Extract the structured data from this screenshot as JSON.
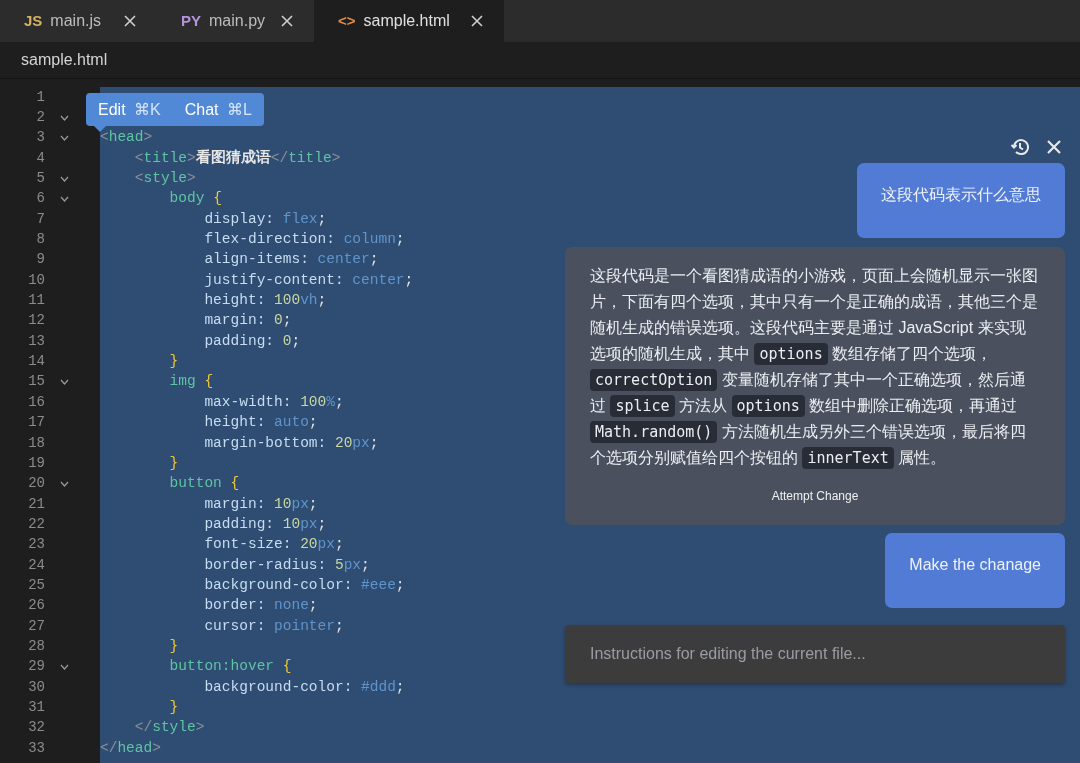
{
  "tabs": [
    {
      "icon": "JS",
      "color": "#d6b25e",
      "label": "main.js",
      "selected": false
    },
    {
      "icon": "PY",
      "color": "#b493d9",
      "label": "main.py",
      "selected": false
    },
    {
      "icon": "<>",
      "color": "#e08a4c",
      "label": "sample.html",
      "selected": true
    }
  ],
  "breadcrumb": "sample.html",
  "editor": {
    "lines": [
      {
        "number": "1",
        "foldable": false
      },
      {
        "number": "2",
        "foldable": true
      },
      {
        "number": "3",
        "foldable": true,
        "tokens": [
          {
            "kind": "punct",
            "t": "<"
          },
          {
            "kind": "tag",
            "t": "head"
          },
          {
            "kind": "punct",
            "t": ">"
          }
        ]
      },
      {
        "number": "4",
        "foldable": false,
        "tokens": [
          {
            "kind": "punct",
            "t": "    <"
          },
          {
            "kind": "tag",
            "t": "title"
          },
          {
            "kind": "punct",
            "t": ">"
          },
          {
            "kind": "text",
            "t": "看图猜成语"
          },
          {
            "kind": "punct",
            "t": "</"
          },
          {
            "kind": "tag",
            "t": "title"
          },
          {
            "kind": "punct",
            "t": ">"
          }
        ]
      },
      {
        "number": "5",
        "foldable": true,
        "tokens": [
          {
            "kind": "punct",
            "t": "    <"
          },
          {
            "kind": "tag",
            "t": "style"
          },
          {
            "kind": "punct",
            "t": ">"
          }
        ]
      },
      {
        "number": "6",
        "foldable": true,
        "tokens": [
          {
            "kind": "tag",
            "t": "        body "
          },
          {
            "kind": "brace",
            "t": "{"
          }
        ]
      },
      {
        "number": "7",
        "foldable": false,
        "tokens": [
          {
            "kind": "prop",
            "t": "            display: "
          },
          {
            "kind": "value",
            "t": "flex"
          },
          {
            "kind": "text",
            "t": ";"
          }
        ]
      },
      {
        "number": "8",
        "foldable": false,
        "tokens": [
          {
            "kind": "prop",
            "t": "            flex-direction: "
          },
          {
            "kind": "value",
            "t": "column"
          },
          {
            "kind": "text",
            "t": ";"
          }
        ]
      },
      {
        "number": "9",
        "foldable": false,
        "tokens": [
          {
            "kind": "prop",
            "t": "            align-items: "
          },
          {
            "kind": "value",
            "t": "center"
          },
          {
            "kind": "text",
            "t": ";"
          }
        ]
      },
      {
        "number": "10",
        "foldable": false,
        "tokens": [
          {
            "kind": "prop",
            "t": "            justify-content: "
          },
          {
            "kind": "value",
            "t": "center"
          },
          {
            "kind": "text",
            "t": ";"
          }
        ]
      },
      {
        "number": "11",
        "foldable": false,
        "tokens": [
          {
            "kind": "prop",
            "t": "            height: "
          },
          {
            "kind": "num",
            "t": "100"
          },
          {
            "kind": "value",
            "t": "vh"
          },
          {
            "kind": "text",
            "t": ";"
          }
        ]
      },
      {
        "number": "12",
        "foldable": false,
        "tokens": [
          {
            "kind": "prop",
            "t": "            margin: "
          },
          {
            "kind": "num",
            "t": "0"
          },
          {
            "kind": "text",
            "t": ";"
          }
        ]
      },
      {
        "number": "13",
        "foldable": false,
        "tokens": [
          {
            "kind": "prop",
            "t": "            padding: "
          },
          {
            "kind": "num",
            "t": "0"
          },
          {
            "kind": "text",
            "t": ";"
          }
        ]
      },
      {
        "number": "14",
        "foldable": false,
        "tokens": [
          {
            "kind": "brace",
            "t": "        }"
          }
        ]
      },
      {
        "number": "15",
        "foldable": true,
        "tokens": [
          {
            "kind": "tag",
            "t": "        img "
          },
          {
            "kind": "brace",
            "t": "{"
          }
        ]
      },
      {
        "number": "16",
        "foldable": false,
        "tokens": [
          {
            "kind": "prop",
            "t": "            max-width: "
          },
          {
            "kind": "num",
            "t": "100"
          },
          {
            "kind": "value",
            "t": "%"
          },
          {
            "kind": "text",
            "t": ";"
          }
        ]
      },
      {
        "number": "17",
        "foldable": false,
        "tokens": [
          {
            "kind": "prop",
            "t": "            height: "
          },
          {
            "kind": "value",
            "t": "auto"
          },
          {
            "kind": "text",
            "t": ";"
          }
        ]
      },
      {
        "number": "18",
        "foldable": false,
        "tokens": [
          {
            "kind": "prop",
            "t": "            margin-bottom: "
          },
          {
            "kind": "num",
            "t": "20"
          },
          {
            "kind": "value",
            "t": "px"
          },
          {
            "kind": "text",
            "t": ";"
          }
        ]
      },
      {
        "number": "19",
        "foldable": false,
        "tokens": [
          {
            "kind": "brace",
            "t": "        }"
          }
        ]
      },
      {
        "number": "20",
        "foldable": true,
        "tokens": [
          {
            "kind": "tag",
            "t": "        button "
          },
          {
            "kind": "brace",
            "t": "{"
          }
        ]
      },
      {
        "number": "21",
        "foldable": false,
        "tokens": [
          {
            "kind": "prop",
            "t": "            margin: "
          },
          {
            "kind": "num",
            "t": "10"
          },
          {
            "kind": "value",
            "t": "px"
          },
          {
            "kind": "text",
            "t": ";"
          }
        ]
      },
      {
        "number": "22",
        "foldable": false,
        "tokens": [
          {
            "kind": "prop",
            "t": "            padding: "
          },
          {
            "kind": "num",
            "t": "10"
          },
          {
            "kind": "value",
            "t": "px"
          },
          {
            "kind": "text",
            "t": ";"
          }
        ]
      },
      {
        "number": "23",
        "foldable": false,
        "tokens": [
          {
            "kind": "prop",
            "t": "            font-size: "
          },
          {
            "kind": "num",
            "t": "20"
          },
          {
            "kind": "value",
            "t": "px"
          },
          {
            "kind": "text",
            "t": ";"
          }
        ]
      },
      {
        "number": "24",
        "foldable": false,
        "tokens": [
          {
            "kind": "prop",
            "t": "            border-radius: "
          },
          {
            "kind": "num",
            "t": "5"
          },
          {
            "kind": "value",
            "t": "px"
          },
          {
            "kind": "text",
            "t": ";"
          }
        ]
      },
      {
        "number": "25",
        "foldable": false,
        "tokens": [
          {
            "kind": "prop",
            "t": "            background-color: "
          },
          {
            "kind": "value",
            "t": "#eee"
          },
          {
            "kind": "text",
            "t": ";"
          }
        ]
      },
      {
        "number": "26",
        "foldable": false,
        "tokens": [
          {
            "kind": "prop",
            "t": "            border: "
          },
          {
            "kind": "value",
            "t": "none"
          },
          {
            "kind": "text",
            "t": ";"
          }
        ]
      },
      {
        "number": "27",
        "foldable": false,
        "tokens": [
          {
            "kind": "prop",
            "t": "            cursor: "
          },
          {
            "kind": "value",
            "t": "pointer"
          },
          {
            "kind": "text",
            "t": ";"
          }
        ]
      },
      {
        "number": "28",
        "foldable": false,
        "tokens": [
          {
            "kind": "brace",
            "t": "        }"
          }
        ]
      },
      {
        "number": "29",
        "foldable": true,
        "tokens": [
          {
            "kind": "tag",
            "t": "        button:hover "
          },
          {
            "kind": "brace",
            "t": "{"
          }
        ]
      },
      {
        "number": "30",
        "foldable": false,
        "tokens": [
          {
            "kind": "prop",
            "t": "            background-color: "
          },
          {
            "kind": "value",
            "t": "#ddd"
          },
          {
            "kind": "text",
            "t": ";"
          }
        ]
      },
      {
        "number": "31",
        "foldable": false,
        "tokens": [
          {
            "kind": "brace",
            "t": "        }"
          }
        ]
      },
      {
        "number": "32",
        "foldable": false,
        "tokens": [
          {
            "kind": "punct",
            "t": "    </"
          },
          {
            "kind": "tag",
            "t": "style"
          },
          {
            "kind": "punct",
            "t": ">"
          }
        ]
      },
      {
        "number": "33",
        "foldable": false,
        "tokens": [
          {
            "kind": "punct",
            "t": "</"
          },
          {
            "kind": "tag",
            "t": "head"
          },
          {
            "kind": "punct",
            "t": ">"
          }
        ]
      }
    ]
  },
  "popup": [
    {
      "label": "Edit",
      "shortcut": "⌘K"
    },
    {
      "label": "Chat",
      "shortcut": "⌘L"
    }
  ],
  "chat": {
    "messages": [
      {
        "kind": "user",
        "text": "这段代码表示什么意思"
      },
      {
        "kind": "assistant",
        "segments": [
          {
            "kind": "text",
            "text": "这段代码是一个看图猜成语的小游戏，页面上会随机显示一张图片，下面有四个选项，其中只有一个是正确的成语，其他三个是随机生成的错误选项。这段代码主要是通过 JavaScript 来实现选项的随机生成，其中 "
          },
          {
            "kind": "code",
            "text": "options"
          },
          {
            "kind": "text",
            "text": " 数组存储了四个选项，"
          },
          {
            "kind": "code",
            "text": "correctOption"
          },
          {
            "kind": "text",
            "text": " 变量随机存储了其中一个正确选项，然后通过 "
          },
          {
            "kind": "code",
            "text": "splice"
          },
          {
            "kind": "text",
            "text": " 方法从 "
          },
          {
            "kind": "code",
            "text": "options"
          },
          {
            "kind": "text",
            "text": " 数组中删除正确选项，再通过 "
          },
          {
            "kind": "code",
            "text": "Math.random()"
          },
          {
            "kind": "text",
            "text": " 方法随机生成另外三个错误选项，最后将四个选项分别赋值给四个按钮的 "
          },
          {
            "kind": "code",
            "text": "innerText"
          },
          {
            "kind": "text",
            "text": " 属性。"
          }
        ],
        "action": "Attempt Change"
      },
      {
        "kind": "user",
        "text": "Make the chanage"
      }
    ],
    "input": {
      "placeholder": "Instructions for editing the current file..."
    }
  }
}
